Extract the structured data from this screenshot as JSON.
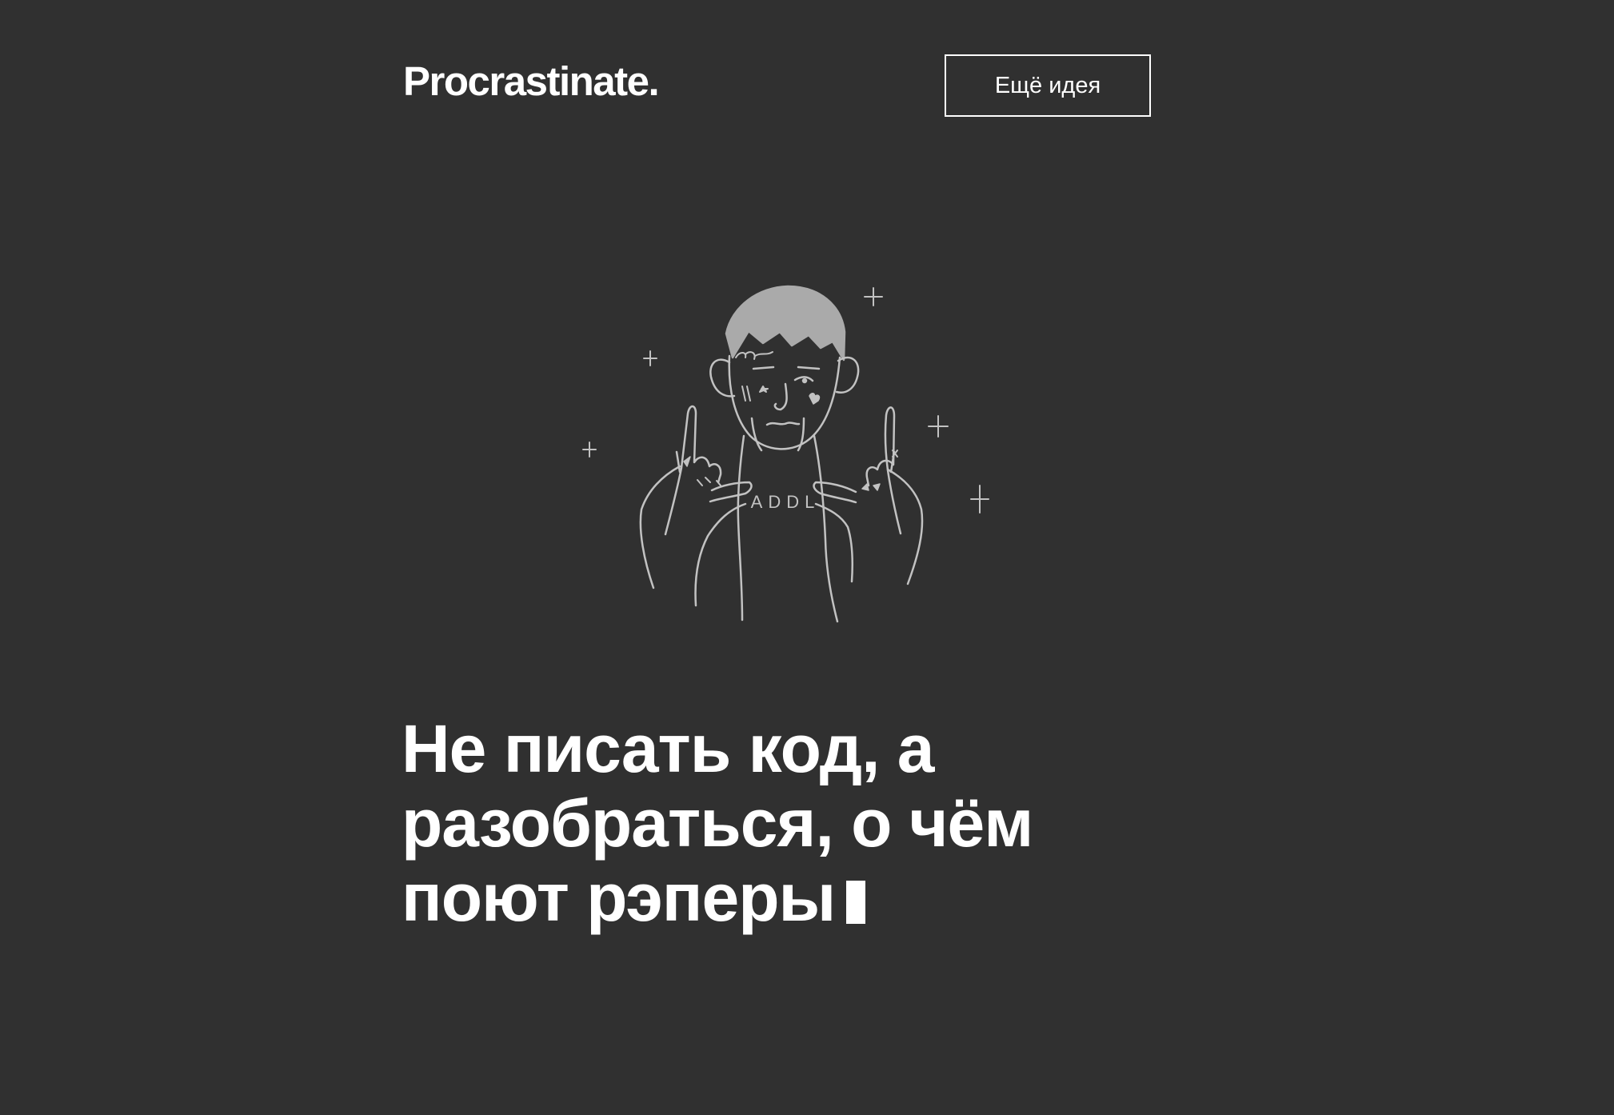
{
  "header": {
    "logo": "Procrastinate.",
    "more_button_label": "Ещё идея"
  },
  "illustration": {
    "icon": "rapper-illustration-icon",
    "shirt_text": "ADDL",
    "line_color": "#c2c2c2"
  },
  "headline": {
    "lines": [
      "Не писать код, а",
      "разобраться, о чём",
      "поют рэперы"
    ]
  },
  "colors": {
    "background": "#303030",
    "text": "#ffffff",
    "button_border": "#ffffff"
  }
}
